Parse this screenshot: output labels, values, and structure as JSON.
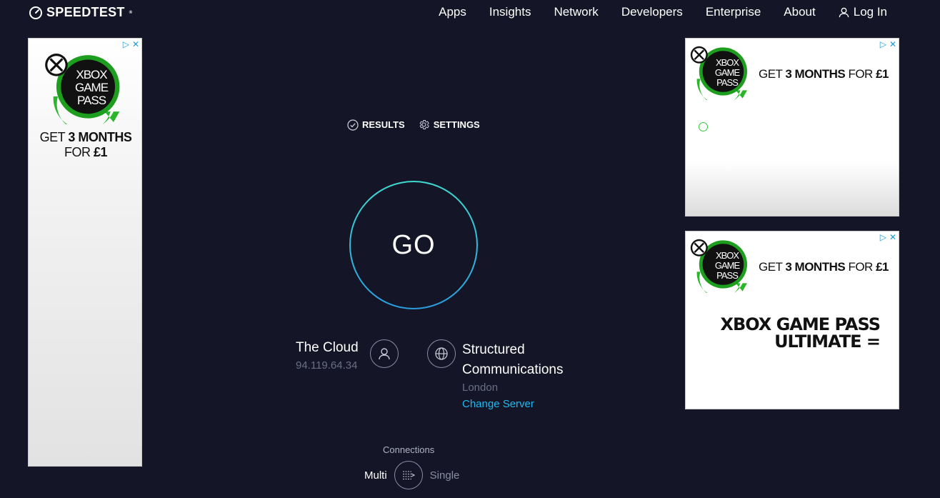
{
  "header": {
    "logo_text": "SPEEDTEST",
    "logo_tm": "®",
    "nav": [
      "Apps",
      "Insights",
      "Network",
      "Developers",
      "Enterprise",
      "About"
    ],
    "login_label": "Log In"
  },
  "ads": {
    "badge_line1": "XBOX",
    "badge_line2": "GAME",
    "badge_line3": "PASS",
    "left": {
      "line1_pre": "GET ",
      "line1_bold": "3 MONTHS",
      "line2_pre": "FOR ",
      "line2_bold": "£1"
    },
    "right1": {
      "pre": "GET ",
      "bold1": "3 MONTHS",
      "mid": " FOR ",
      "bold2": "£1"
    },
    "right2": {
      "pre": "GET ",
      "bold1": "3 MONTHS",
      "mid": " FOR ",
      "bold2": "£1",
      "headline1": "XBOX GAME PASS",
      "headline2": "ULTIMATE ="
    }
  },
  "subnav": {
    "results": "RESULTS",
    "settings": "SETTINGS"
  },
  "go_label": "GO",
  "isp": {
    "name": "The Cloud",
    "ip": "94.119.64.34"
  },
  "server": {
    "name_line1": "Structured",
    "name_line2": "Communications",
    "location": "London",
    "change_label": "Change Server"
  },
  "connections": {
    "label": "Connections",
    "multi": "Multi",
    "single": "Single"
  },
  "colors": {
    "background": "#141526",
    "accent_cyan": "#3fd9d0",
    "accent_blue": "#1cbbf3",
    "xbox_green": "#107c10"
  }
}
